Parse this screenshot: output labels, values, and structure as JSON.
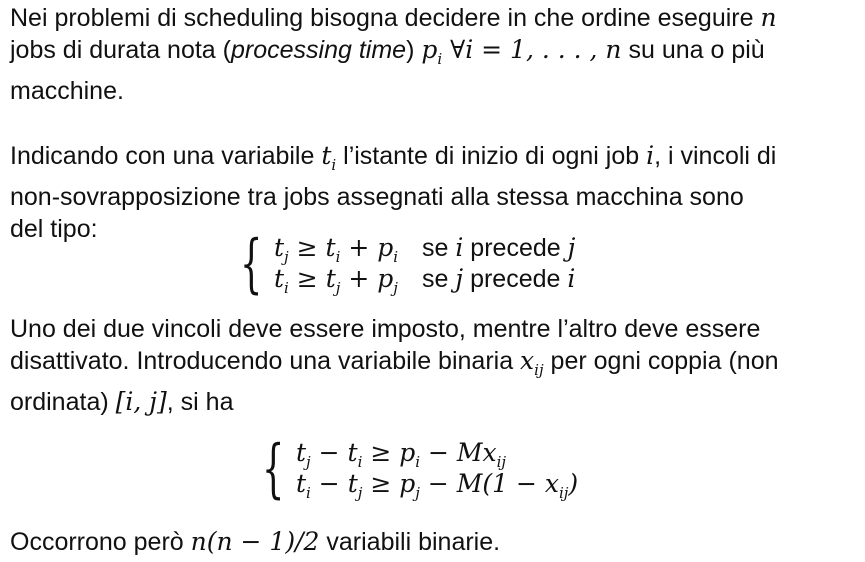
{
  "paragraphs": {
    "p1": {
      "line1_a": "Nei problemi di scheduling bisogna decidere in che ordine eseguire ",
      "line1_var": "n",
      "line2_a": "jobs di durata nota (",
      "line2_em": "processing time",
      "line2_b": ") ",
      "line2_p": "p",
      "line2_sub": "i",
      "line2_math": " ∀i = 1, . . . , n",
      "line2_c": " su una o più",
      "line3": "macchine."
    },
    "p2": {
      "line1_a": "Indicando con una variabile ",
      "line1_t": "t",
      "line1_sub": "i",
      "line1_b": " l’istante di inizio di ogni job ",
      "line1_i": "i",
      "line1_c": ", i vincoli di",
      "line2": "non-sovrapposizione tra jobs assegnati alla stessa macchina sono",
      "line3": "del tipo:"
    },
    "p3": {
      "line1": "Uno dei due vincoli deve essere imposto, mentre l’altro deve essere",
      "line2_a": "disattivato. Introducendo una variabile binaria ",
      "line2_x": "x",
      "line2_sub": "ij",
      "line2_b": " per ogni coppia (non",
      "line3_a": "ordinata) ",
      "line3_math": "[i, j]",
      "line3_b": ", si ha"
    },
    "p4": {
      "text_a": "Occorrono però ",
      "math": "n(n − 1)/2",
      "text_b": " variabili binarie."
    }
  },
  "system1": {
    "row1": {
      "lhs": "t",
      "lhs_sub": "j",
      "rel": " ≥ t",
      "rel_sub": "i",
      "rhs": " + p",
      "rhs_sub": "i",
      "cond_a": "se ",
      "cond_var1": "i",
      "cond_b": " precede ",
      "cond_var2": "j"
    },
    "row2": {
      "lhs": "t",
      "lhs_sub": "i",
      "rel": " ≥ t",
      "rel_sub": "j",
      "rhs": " + p",
      "rhs_sub": "j",
      "cond_a": "se ",
      "cond_var1": "j",
      "cond_b": " precede ",
      "cond_var2": "i"
    }
  },
  "system2": {
    "row1": {
      "a": "t",
      "a_sub": "j",
      "b": " − t",
      "b_sub": "i",
      "c": " ≥ p",
      "c_sub": "i",
      "d": " − Mx",
      "d_sub": "ij",
      "e": ""
    },
    "row2": {
      "a": "t",
      "a_sub": "i",
      "b": " − t",
      "b_sub": "j",
      "c": " ≥ p",
      "c_sub": "j",
      "d": " − M(1 − x",
      "d_sub": "ij",
      "e": ")"
    }
  }
}
